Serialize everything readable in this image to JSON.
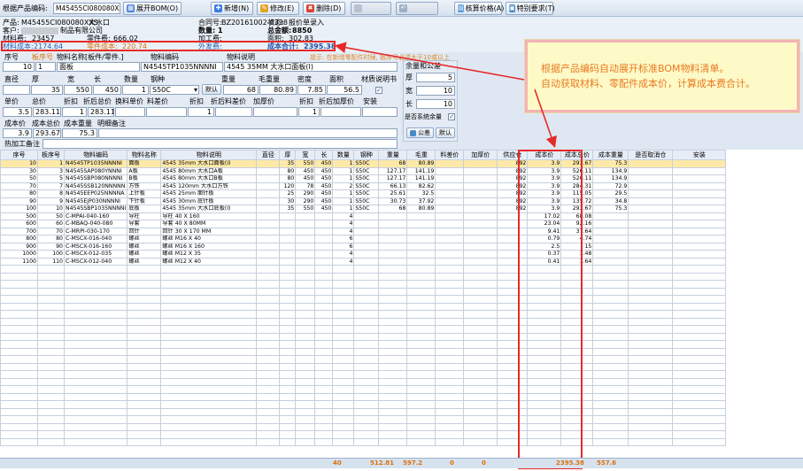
{
  "toolbar": {
    "code_label": "根据产品编码:",
    "code_value": "M45455CI080080XXS",
    "buttons": [
      {
        "label": "展开BOM(O)",
        "icon": "expand-icon"
      },
      {
        "label": "新增(N)",
        "icon": "new-icon"
      },
      {
        "label": "修改(E)",
        "icon": "edit-icon"
      },
      {
        "label": "删除(D)",
        "icon": "delete-icon"
      },
      {
        "label": "",
        "icon": "disabled-icon"
      },
      {
        "label": "",
        "icon": "undo-icon"
      },
      {
        "label": "核算价格(A)",
        "icon": "calc-icon"
      },
      {
        "label": "特别要求(T)",
        "icon": "special-icon"
      }
    ]
  },
  "header": {
    "product_label": "产品:",
    "product_value": "M45455CI080080XXS",
    "size_value": "大水口",
    "contract_label": "合同号:",
    "contract_value": "BZ20161002-0338",
    "status_label": "状态:",
    "status_value": "报价单录入",
    "customer_label": "客户:",
    "customer_value": "制品有限公司",
    "qty_label": "数量:",
    "qty_value": "1",
    "total_label": "总金额:",
    "total_value": "8850",
    "material_fee_label": "材料费:",
    "material_fee_value": "23457",
    "parts_fee_label": "零件费:",
    "parts_fee_value": "666.02",
    "process_fee_label": "加工费:",
    "process_fee_value": "",
    "area_label": "面积:",
    "area_value": "302.83",
    "material_cost_label": "材料成本:",
    "material_cost_value": "2174.64",
    "parts_cost_label": "零件成本:",
    "parts_cost_value": "220.74",
    "outsource_label": "外发费:",
    "outsource_value": "",
    "cost_total_label": "成本合计:",
    "cost_total_value": "2395.38"
  },
  "form": {
    "hint": "提示: 在新增零配件时候, 板序号必须大于10或以上",
    "seq_label": "序号",
    "board_seq_label": "板序号",
    "name_label": "物料名称[板件/零件.]",
    "code_label": "物料编码",
    "desc_label": "物料说明",
    "seq_value": "10",
    "board_seq_value": "1",
    "name_value": "面板",
    "code_value": "N4545TP1035NNNNI",
    "desc_value": "4545 35MM 大水口面板(I)",
    "dia_label": "直径",
    "thick_label": "厚",
    "width_label": "宽",
    "len_label": "长",
    "qty_label": "数量",
    "steel_label": "钢种",
    "weight_label": "重量",
    "gross_label": "毛重量",
    "density_label": "密度",
    "area_label": "面积",
    "spec_label": "材质说明书",
    "dia_value": "",
    "thick_value": "35",
    "width_value": "550",
    "len_value": "450",
    "qty_value": "1",
    "steel_value": "S50C",
    "default_btn": "默认",
    "weight_value": "68",
    "gross_value": "80.89",
    "density_value": "7.85",
    "area_value": "56.5",
    "price_label": "单价",
    "total_label": "总价",
    "discount_label": "折扣",
    "disc_total_label": "折后总价",
    "conv_price_label": "换料单价",
    "diff_label": "料差价",
    "discount2_label": "折扣",
    "disc_diff_label": "折后料差价",
    "thick_price_label": "加厚价",
    "discount3_label": "折扣",
    "disc_thick_label": "折后加厚价",
    "install_label": "安装",
    "price_value": "3.5",
    "total_value": "283.115",
    "discount_value": "1",
    "disc_total_value": "283.115",
    "conv_price_value": "",
    "diff_value": "",
    "discount2_value": "1",
    "disc_diff_value": "",
    "thick_price_value": "",
    "discount3_value": "1",
    "disc_thick_value": "",
    "install_value": "",
    "unit_cost_label": "成本价",
    "cost_total_label": "成本总价",
    "cost_weight_label": "成本重量",
    "detail_note_label": "明细备注",
    "unit_cost_value": "3.9",
    "cost_total_value": "293.67",
    "cost_weight_value": "75.3",
    "detail_note_value": "",
    "heat_note_label": "热加工备注",
    "heat_note_value": ""
  },
  "margin": {
    "title": "余量和公差",
    "thick_label": "厚",
    "thick_value": "5",
    "width_label": "宽",
    "width_value": "10",
    "len_label": "长",
    "len_value": "10",
    "sys_label": "是否系统余量",
    "tol_btn": "公差",
    "default_btn": "默认"
  },
  "callout": {
    "line1": "根据产品编码自动展开标准BOM物料清单。",
    "line2": "自动获取材料、零配件成本价，计算成本费合计。"
  },
  "table": {
    "headers": [
      "序号",
      "板序号",
      "物料编码",
      "物料名称",
      "物料说明",
      "直径",
      "厚",
      "宽",
      "长",
      "数量",
      "钢种",
      "重量",
      "毛重",
      "料差价",
      "加厚价",
      "供应仓",
      "成本价",
      "成本总价",
      "成本重量",
      "是否取消仓",
      "安装"
    ],
    "rows": [
      [
        "10",
        "1",
        "N4545TP1035NNNNI",
        "面板",
        "4545 35mm 大水口面板(I)",
        "",
        "35",
        "550",
        "450",
        "1",
        "S50C",
        "68",
        "80.89",
        "",
        "",
        "892",
        "3.9",
        "293.67",
        "75.3",
        "",
        ""
      ],
      [
        "30",
        "3",
        "N4545SAP080YNNNI",
        "A板",
        "4545 80mm 大水口A板",
        "",
        "80",
        "450",
        "450",
        "1",
        "S50C",
        "127.17",
        "141.19",
        "",
        "",
        "892",
        "3.9",
        "526.11",
        "134.9",
        "",
        ""
      ],
      [
        "50",
        "5",
        "N4545SBP080NNNNI",
        "B板",
        "4545 80mm 大水口B板",
        "",
        "80",
        "450",
        "450",
        "1",
        "S50C",
        "127.17",
        "141.19",
        "",
        "",
        "892",
        "3.9",
        "526.11",
        "134.9",
        "",
        ""
      ],
      [
        "70",
        "7",
        "N4545SSB120NNNNN",
        "方铁",
        "4545 120mm 大水口方铁",
        "",
        "120",
        "78",
        "450",
        "2",
        "S50C",
        "66.13",
        "82.62",
        "",
        "",
        "892",
        "3.9",
        "284.31",
        "72.9",
        "",
        ""
      ],
      [
        "80",
        "8",
        "N4545EEP025NNNNA",
        "上针板",
        "4545 25mm 面针板",
        "",
        "25",
        "290",
        "450",
        "1",
        "S50C",
        "25.61",
        "32.5",
        "",
        "",
        "892",
        "3.9",
        "115.05",
        "29.5",
        "",
        ""
      ],
      [
        "90",
        "9",
        "N4545EJP030NNNNI",
        "下针板",
        "4545 30mm 底针板",
        "",
        "30",
        "290",
        "450",
        "1",
        "S50C",
        "30.73",
        "37.92",
        "",
        "",
        "892",
        "3.9",
        "135.72",
        "34.8",
        "",
        ""
      ],
      [
        "100",
        "10",
        "N4545SBP1035NNNNI",
        "底板",
        "4545 35mm 大水口底板(I)",
        "",
        "35",
        "550",
        "450",
        "1",
        "S50C",
        "68",
        "80.89",
        "",
        "",
        "892",
        "3.9",
        "293.67",
        "75.3",
        "",
        ""
      ],
      [
        "500",
        "50",
        "C-MPAI-040-160",
        "导柱",
        "导柱 40 X 160",
        "",
        "",
        "",
        "",
        "4",
        "",
        "",
        "",
        "",
        "",
        "",
        "17.02",
        "68.08",
        "",
        "",
        ""
      ],
      [
        "600",
        "60",
        "C-MBAQ-040-080",
        "导套",
        "导套 40 X 80MM",
        "",
        "",
        "",
        "",
        "4",
        "",
        "",
        "",
        "",
        "",
        "",
        "23.04",
        "92.16",
        "",
        "",
        ""
      ],
      [
        "700",
        "70",
        "C-MRPI-030-170",
        "回针",
        "回针 30 X 170 MM",
        "",
        "",
        "",
        "",
        "4",
        "",
        "",
        "",
        "",
        "",
        "",
        "9.41",
        "37.64",
        "",
        "",
        ""
      ],
      [
        "800",
        "80",
        "C-MSCX-016-040",
        "螺丝",
        "螺丝 M16 X 40",
        "",
        "",
        "",
        "",
        "6",
        "",
        "",
        "",
        "",
        "",
        "",
        "0.79",
        "4.74",
        "",
        "",
        ""
      ],
      [
        "900",
        "90",
        "C-MSCX-016-160",
        "螺丝",
        "螺丝 M16 X 160",
        "",
        "",
        "",
        "",
        "6",
        "",
        "",
        "",
        "",
        "",
        "",
        "2.5",
        "15",
        "",
        "",
        ""
      ],
      [
        "1000",
        "100",
        "C-MSCX-012-035",
        "螺丝",
        "螺丝 M12 X 35",
        "",
        "",
        "",
        "",
        "4",
        "",
        "",
        "",
        "",
        "",
        "",
        "0.37",
        "1.48",
        "",
        "",
        ""
      ],
      [
        "1100",
        "110",
        "C-MSCX-012-040",
        "螺丝",
        "螺丝 M12 X 40",
        "",
        "",
        "",
        "",
        "4",
        "",
        "",
        "",
        "",
        "",
        "",
        "0.41",
        "1.64",
        "",
        "",
        ""
      ]
    ],
    "totals": {
      "qty": "40",
      "weight": "512.81",
      "gross": "597.2",
      "diff": "0",
      "thick": "0",
      "cost_total": "2395.38",
      "cost_weight": "557.6"
    }
  },
  "colors": {
    "highlight": "#e52a2a",
    "callout_text": "#ea7a20",
    "selected_row": "#ffe9a8"
  }
}
